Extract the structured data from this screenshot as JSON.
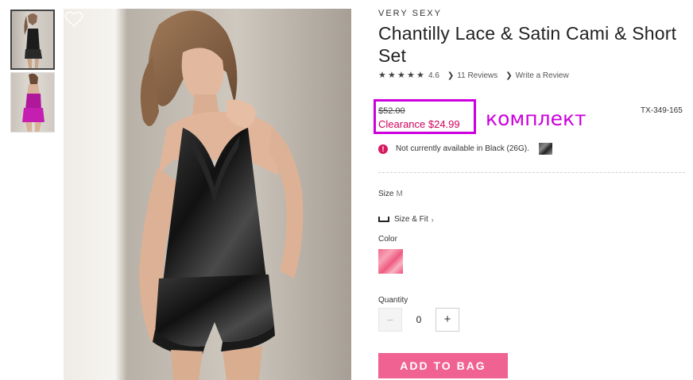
{
  "product": {
    "brand": "VERY SEXY",
    "title": "Chantilly Lace & Satin Cami & Short Set",
    "rating": "4.6",
    "reviews_link": "11 Reviews",
    "write_review_link": "Write a Review",
    "old_price": "$52.00",
    "sale_price": "Clearance $24.99",
    "sku": "TX-349-165",
    "annotation": "комплект",
    "availability": "Not currently available in Black (26G).",
    "size_label": "Size",
    "size_value": "M",
    "size_fit_link": "Size & Fit",
    "color_label": "Color",
    "quantity_label": "Quantity",
    "quantity_value": "0",
    "qty_minus": "−",
    "qty_plus": "+",
    "add_to_bag": "ADD TO BAG"
  },
  "icons": {
    "wishlist": "heart-icon",
    "alert": "alert-icon",
    "ruler": "ruler-icon",
    "chevron": "chevron-right-icon",
    "star": "star-icon"
  },
  "colors": {
    "sale": "#d0005b",
    "highlight": "#cc00dd",
    "button": "#f06292",
    "swatch": "#f26a8d"
  }
}
